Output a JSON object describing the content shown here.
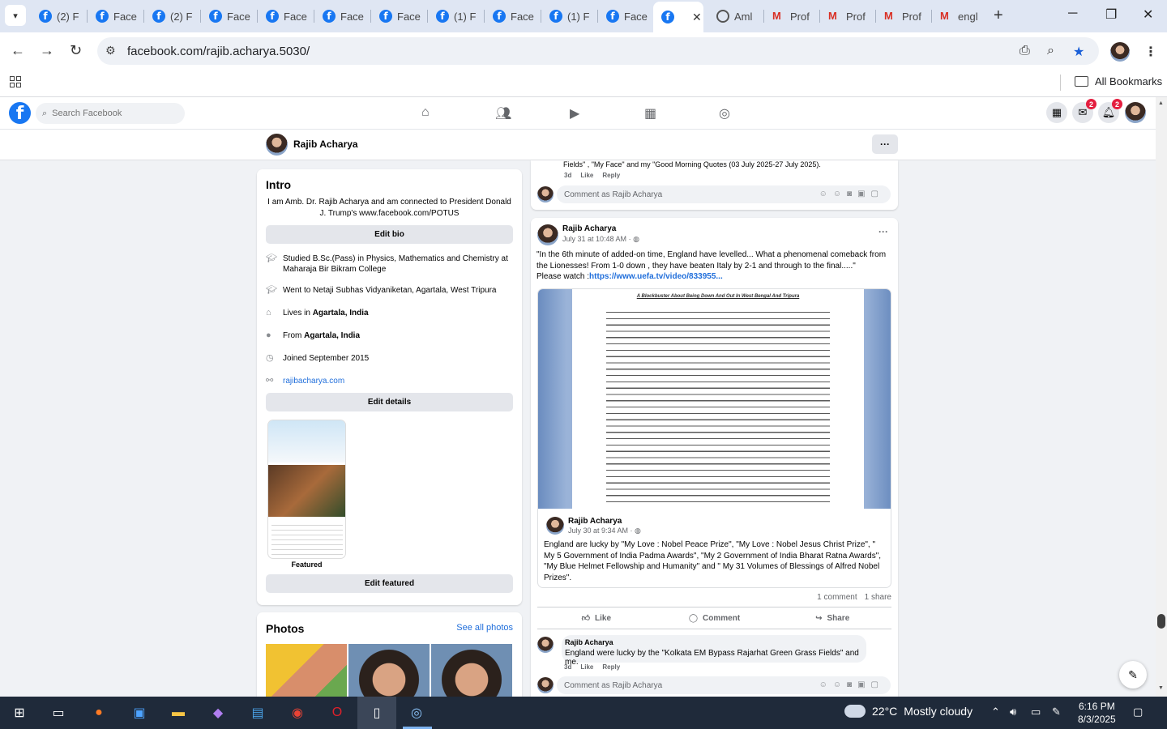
{
  "browser": {
    "tabs": [
      {
        "icon": "facebook-icon",
        "label": "(2) F"
      },
      {
        "icon": "facebook-icon",
        "label": "Face"
      },
      {
        "icon": "facebook-icon",
        "label": "(2) F"
      },
      {
        "icon": "facebook-icon",
        "label": "Face"
      },
      {
        "icon": "facebook-icon",
        "label": "Face"
      },
      {
        "icon": "facebook-icon",
        "label": "Face"
      },
      {
        "icon": "facebook-icon",
        "label": "Face"
      },
      {
        "icon": "facebook-icon",
        "label": "(1) F"
      },
      {
        "icon": "facebook-icon",
        "label": "Face"
      },
      {
        "icon": "facebook-icon",
        "label": "(1) F"
      },
      {
        "icon": "facebook-icon",
        "label": "Face"
      },
      {
        "icon": "globe-icon",
        "label": "Aml"
      },
      {
        "icon": "gmail-icon",
        "label": "Prof"
      },
      {
        "icon": "gmail-icon",
        "label": "Prof"
      },
      {
        "icon": "gmail-icon",
        "label": "Prof"
      },
      {
        "icon": "gmail-icon",
        "label": "engl"
      }
    ],
    "url": "facebook.com/rajib.acharya.5030/",
    "all_bookmarks": "All Bookmarks"
  },
  "facebook": {
    "search_placeholder": "Search Facebook",
    "messenger_badge": "2",
    "notifications_badge": "2",
    "profile_name": "Rajib Acharya"
  },
  "intro": {
    "heading": "Intro",
    "bio": "I am Amb. Dr. Rajib Acharya and am connected to President Donald J. Trump's www.facebook.com/POTUS",
    "edit_bio": "Edit bio",
    "details": [
      {
        "icon": "graduation-cap-icon",
        "text": "Studied B.Sc.(Pass) in Physics, Mathematics and Chemistry at Maharaja Bir Bikram College",
        "bold": ""
      },
      {
        "icon": "graduation-cap-icon",
        "text": "Went to Netaji Subhas Vidyaniketan, Agartala, West Tripura",
        "bold": ""
      },
      {
        "icon": "home-icon",
        "text": "Lives in ",
        "bold": "Agartala, India"
      },
      {
        "icon": "location-pin-icon",
        "text": "From ",
        "bold": "Agartala, India"
      },
      {
        "icon": "clock-icon",
        "text": "Joined September 2015",
        "bold": ""
      }
    ],
    "website": "rajibacharya.com",
    "edit_details": "Edit details",
    "featured_label": "Featured",
    "edit_featured": "Edit featured"
  },
  "photos": {
    "heading": "Photos",
    "see_all": "See all photos"
  },
  "feed": {
    "prev_comment_tail": "Fields\" , \"My Face\" and my \"Good Morning Quotes (03 July 2025-27 July 2025).",
    "prev_comment_age": "3d",
    "like": "Like",
    "reply": "Reply",
    "comment_placeholder": "Comment as Rajib Acharya",
    "post": {
      "author": "Rajib Acharya",
      "timestamp": "July 31 at 10:48 AM",
      "text": "\"In the 6th minute of added-on time, England have levelled... What a phenomenal comeback from the Lionesses! From 1-0 down , they have beaten Italy by 2-1 and through to the final.....\"",
      "watch_prefix": "Please watch :",
      "watch_link": "https://www.uefa.tv/video/833955...",
      "doc_title": "A Blockbuster About Being Down And Out In West Bengal And Tripura",
      "shared_author": "Rajib Acharya",
      "shared_timestamp": "July 30 at 9:34 AM",
      "shared_text": "England are lucky by \"My Love : Nobel Peace Prize\", \"My Love : Nobel Jesus Christ Prize\", \" My 5 Government of India Padma Awards\", \"My 2 Government of India Bharat Ratna Awards\", \"My Blue Helmet Fellowship and Humanity\" and \" My 31 Volumes of Blessings of Alfred Nobel Prizes\".",
      "comments_count": "1 comment",
      "shares_count": "1 share",
      "action_like": "Like",
      "action_comment": "Comment",
      "action_share": "Share",
      "reply_author": "Rajib Acharya",
      "reply_text": "England were lucky by the \"Kolkata EM Bypass Rajarhat Green Grass Fields\" and me.",
      "reply_age": "3d"
    }
  },
  "taskbar": {
    "temperature": "22°C",
    "weather": "Mostly cloudy",
    "time": "6:16 PM",
    "date": "8/3/2025"
  },
  "colors": {
    "facebook_blue": "#1877f2",
    "link_blue": "#216fdb",
    "badge_red": "#e41e3f",
    "taskbar": "#1f2a3a"
  }
}
